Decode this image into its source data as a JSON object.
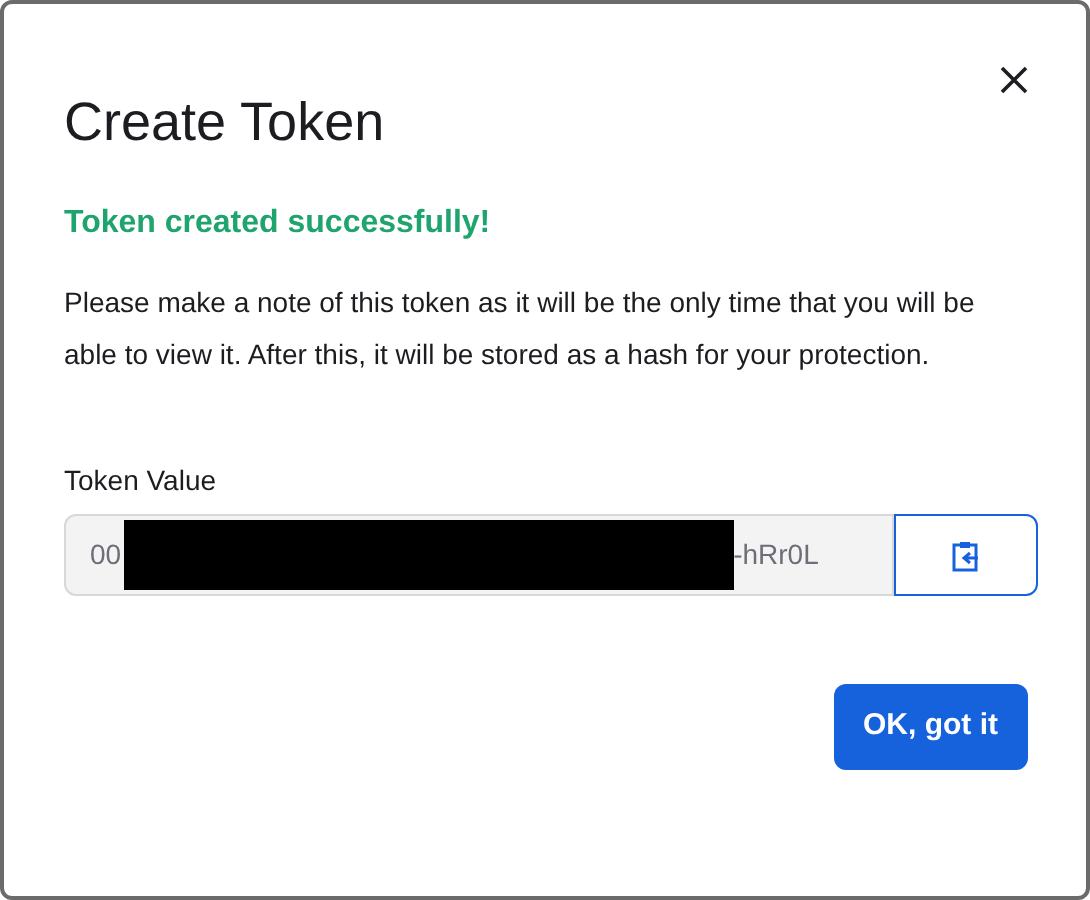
{
  "dialog": {
    "title": "Create Token",
    "success_message": "Token created successfully!",
    "description": "Please make a note of this token as it will be the only time that you will be able to view it. After this, it will be stored as a hash for your protection.",
    "token_field": {
      "label": "Token Value",
      "value_start": "00",
      "value_end": "-hRr0L",
      "redacted": true
    },
    "buttons": [
      "OK, got it"
    ]
  }
}
